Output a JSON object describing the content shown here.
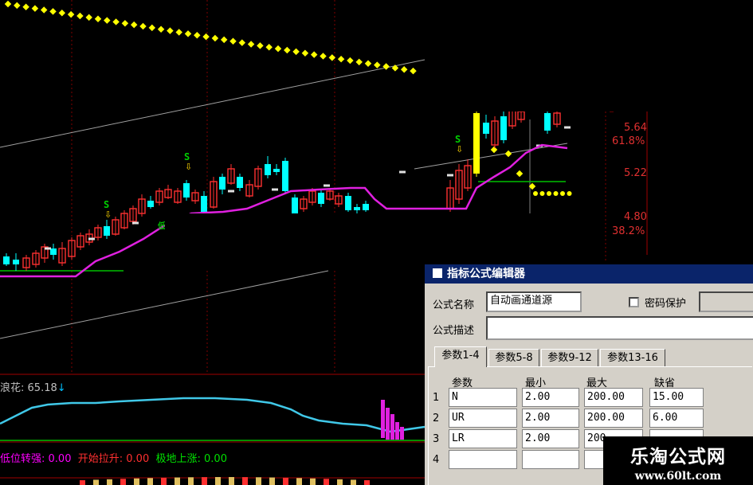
{
  "price_labels": [
    {
      "text": "5.64"
    },
    {
      "text": "61.8%"
    },
    {
      "text": "5.22"
    },
    {
      "text": "4.80"
    },
    {
      "text": "38.2%"
    }
  ],
  "signals": [
    "S",
    "S",
    "S"
  ],
  "indicator1": {
    "name": "浪花:",
    "value": "65.18",
    "arrow": "↓"
  },
  "indicator2": [
    {
      "label": "低位转强:",
      "value": "0.00",
      "color": "#ff00ff"
    },
    {
      "label": "开始拉升:",
      "value": "0.00",
      "color": "#ff3030"
    },
    {
      "label": "极地上涨:",
      "value": "0.00",
      "color": "#00e000"
    }
  ],
  "chart_marker": "低",
  "dialog": {
    "title": "指标公式编辑器",
    "name_label": "公式名称",
    "name_value": "自动画通道源",
    "password_label": "密码保护",
    "desc_label": "公式描述",
    "desc_value": "",
    "tabs": [
      "参数1-4",
      "参数5-8",
      "参数9-12",
      "参数13-16"
    ],
    "active_tab": 0,
    "columns": [
      "参数",
      "最小",
      "最大",
      "缺省"
    ],
    "rows": [
      {
        "num": "1",
        "param": "N",
        "min": "2.00",
        "max": "200.00",
        "default": "15.00"
      },
      {
        "num": "2",
        "param": "UR",
        "min": "2.00",
        "max": "200.00",
        "default": "6.00"
      },
      {
        "num": "3",
        "param": "LR",
        "min": "2.00",
        "max": "200",
        "default": ""
      },
      {
        "num": "4",
        "param": "",
        "min": "",
        "max": "",
        "default": ""
      }
    ]
  },
  "watermark": {
    "line1": "乐淘公式网",
    "line2": "www.60lt.com"
  },
  "colors": {
    "up": "#ff3030",
    "down": "#00ffff",
    "ma": "#e020e0",
    "dots": "#ffff00",
    "grid": "#800000",
    "indicator_line": "#40c8e8"
  }
}
